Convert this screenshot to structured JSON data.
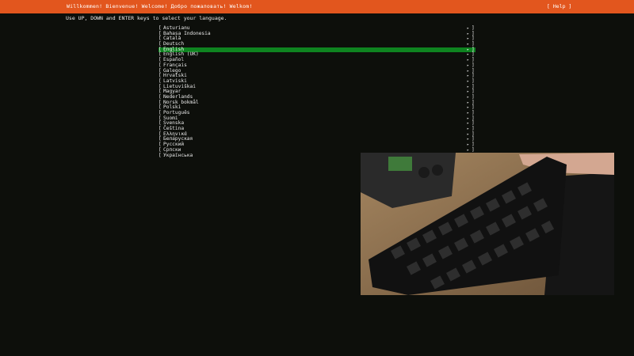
{
  "header": {
    "title": "Willkommen! Bienvenue! Welcome! Добро пожаловать! Welkom!",
    "help_label": "[ Help ]"
  },
  "instructions": "Use UP, DOWN and ENTER keys to select your language.",
  "languages": [
    {
      "label": "Asturianu"
    },
    {
      "label": "Bahasa Indonesia"
    },
    {
      "label": "Català"
    },
    {
      "label": "Deutsch"
    },
    {
      "label": "English",
      "selected": true
    },
    {
      "label": "English (UK)"
    },
    {
      "label": "Español"
    },
    {
      "label": "Français"
    },
    {
      "label": "Galego"
    },
    {
      "label": "Hrvatski"
    },
    {
      "label": "Latviski"
    },
    {
      "label": "Lietuviškai"
    },
    {
      "label": "Magyar"
    },
    {
      "label": "Nederlands"
    },
    {
      "label": "Norsk bokmål"
    },
    {
      "label": "Polski"
    },
    {
      "label": "Português"
    },
    {
      "label": "Suomi"
    },
    {
      "label": "Svenska"
    },
    {
      "label": "Čeština"
    },
    {
      "label": "Ελληνικά"
    },
    {
      "label": "Беларуская"
    },
    {
      "label": "Русский"
    },
    {
      "label": "Српски"
    },
    {
      "label": "Українська"
    }
  ],
  "item_arrow": "▸",
  "bracket_left": "[",
  "bracket_right": "]",
  "colors": {
    "header_bg": "#e2561e",
    "selected_bg": "#0e8420",
    "background": "#0d0f0b"
  }
}
